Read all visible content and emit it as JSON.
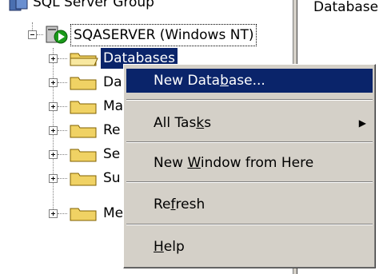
{
  "tree": {
    "root_label": "SQL Server Group",
    "server_label": "SQASERVER (Windows NT)",
    "children": [
      "Databases",
      "Da",
      "Ma",
      "Re",
      "Se",
      "Su",
      "Me"
    ]
  },
  "right_pane": {
    "header": "Database"
  },
  "context_menu": {
    "items": [
      {
        "pre": "New Data",
        "key": "b",
        "post": "ase..."
      },
      {
        "pre": "All Tas",
        "key": "k",
        "post": "s"
      },
      {
        "pre": "New ",
        "key": "W",
        "post": "indow from Here"
      },
      {
        "pre": "Re",
        "key": "f",
        "post": "resh"
      },
      {
        "pre": "",
        "key": "H",
        "post": "elp"
      }
    ]
  },
  "colors": {
    "highlight": "#0a246a",
    "menu_bg": "#d4d0c8",
    "folder": "#f0d264"
  }
}
